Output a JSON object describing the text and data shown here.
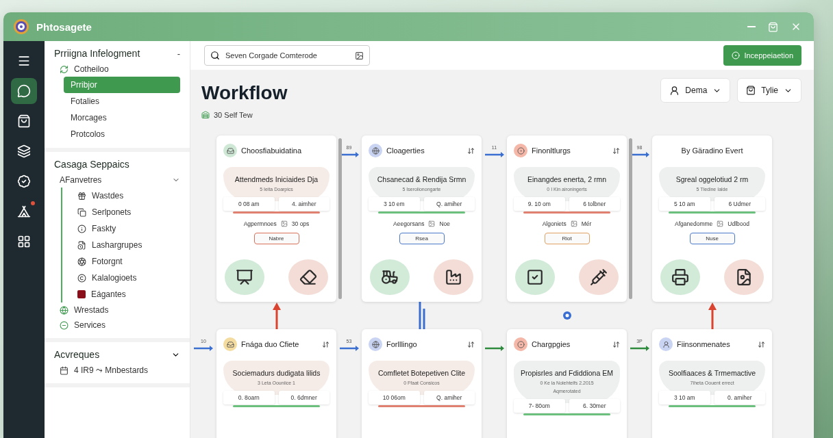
{
  "window": {
    "title": "Phtosagete"
  },
  "rail": [
    {
      "selected": false
    },
    {
      "selected": true
    },
    {
      "selected": false
    },
    {
      "selected": false
    },
    {
      "selected": false
    },
    {
      "selected": false,
      "badge": true
    },
    {
      "selected": false
    }
  ],
  "sidebar": {
    "sections": [
      {
        "title": "Prriigna Infelogment",
        "toggle": "-",
        "groups": [
          {
            "label": "Cotheiloo",
            "children": [
              {
                "label": "Prribjor",
                "selected": true
              },
              {
                "label": "Fotalies",
                "selected": false
              },
              {
                "label": "Morcages",
                "selected": false
              },
              {
                "label": "Protcolos",
                "selected": false
              }
            ]
          }
        ]
      },
      {
        "title": "Casaga Seppaics",
        "groups": [
          {
            "label": "AFanvetres",
            "expanded": true,
            "children": [
              {
                "label": "Wastdes",
                "selected": false
              },
              {
                "label": "Serlponets",
                "selected": false
              },
              {
                "label": "Faskty",
                "selected": false
              },
              {
                "label": "Lashargrupes",
                "selected": false
              },
              {
                "label": "Fotorgnt",
                "selected": false
              },
              {
                "label": "Kalalogioets",
                "selected": false
              },
              {
                "label": "Eágantes",
                "selected": false
              }
            ]
          },
          {
            "label": "Wrestads"
          },
          {
            "label": "Services"
          }
        ]
      },
      {
        "title": "Acvreques",
        "groups": [
          {
            "label": "4 IR9 ⤳ Mnbestards"
          }
        ]
      }
    ]
  },
  "topbar": {
    "search": {
      "placeholder": "Seven Corgade Comterode"
    },
    "action": "Inceppeiaetion"
  },
  "page": {
    "title": "Workflow",
    "subtitle": "30 Self Tew",
    "filters": [
      "Dema",
      "Tylie"
    ]
  },
  "rows": [
    {
      "cards": [
        {
          "title": "Choosfiabuidatina",
          "color": "#cfe8d6",
          "menu": false,
          "scroll": true,
          "summary": "Attendmeds Iniciaides Dja",
          "detail": "5 Ieita Doarpics",
          "times": [
            "0 08 am",
            "4. aimher"
          ],
          "assignee": "Agpermnoes",
          "assign_value": "30 ops",
          "status": {
            "label": "Nabre",
            "color": "#d9705a"
          }
        },
        {
          "connector": {
            "label": "89",
            "color": "#3a6fd1"
          },
          "title": "Cloagerties",
          "color": "#c9d3f2",
          "menu": true,
          "scroll": false,
          "summary": "Chsanecad & Rendija Srmn",
          "detail": "5 Iserolionongarte",
          "times": [
            "3 10 em",
            "Q. amiher"
          ],
          "assignee": "Aeegorsans",
          "assign_value": "Noe",
          "status": {
            "label": "Rsea",
            "color": "#4a79c9"
          }
        },
        {
          "connector": {
            "label": "11",
            "color": "#3a6fd1"
          },
          "title": "Finonltlurgs",
          "color": "#f4b7a8",
          "menu": true,
          "scroll": true,
          "summary": "Einangdes enerta, 2 rmn",
          "detail": "0 I Kin aironingerts",
          "times": [
            "9. 10 om",
            "6 tolbner"
          ],
          "assignee": "Algoniets",
          "assign_value": "Mér",
          "status": {
            "label": "Riot",
            "color": "#e0a060"
          }
        },
        {
          "connector": {
            "label": "98",
            "color": "#3a6fd1"
          },
          "title": "By Gäradino Evert",
          "menu": false,
          "scroll": false,
          "summary": "Sgreal oggelotiud 2 rm",
          "detail": "5 Tledine Ialde",
          "times": [
            "5 10 am",
            "6 Udmer"
          ],
          "assignee": "Afganedomme",
          "assign_value": "Udlbood",
          "status": {
            "label": "Nuse",
            "color": "#4a79c9"
          }
        }
      ]
    },
    {
      "cards": [
        {
          "connector": {
            "label": "10",
            "color": "#3a6fd1"
          },
          "title": "Fnága duo Cfiete",
          "color": "#f4dca0",
          "menu": true,
          "scroll": false,
          "summary": "Sociemadurs dudigata lilids",
          "detail": "3 Leta Oouniice 1",
          "times": [
            "0. 8oarn",
            "0. 6dmner"
          ]
        },
        {
          "connector": {
            "label": "53",
            "color": "#3a6fd1"
          },
          "title": "Forlllingo",
          "color": "#c9d3f2",
          "menu": true,
          "scroll": false,
          "summary": "Comfletet Botepetiven Clite",
          "detail": "0 Ffaat Consicos",
          "times": [
            "10 06om",
            "Q. amiher"
          ]
        },
        {
          "connector": {
            "color": "#2e8b3e"
          },
          "title": "Chargpgies",
          "color": "#f4b7a8",
          "menu": true,
          "scroll": false,
          "summary": "Propisrles and Fdiddiona EM",
          "detail": "0 Ke la Nolehtelfs 2.2015",
          "note": "Aqmerotated",
          "times": [
            "7- 80om",
            "6. 30mer"
          ]
        },
        {
          "connector": {
            "label": "3P",
            "color": "#2e8b3e"
          },
          "title": "Fiinsonmenates",
          "color": "#c9d3f2",
          "menu": true,
          "scroll": false,
          "summary": "Soolfiaaces & Trmemactive",
          "detail": "7Iheta Oouent errect",
          "times": [
            "3 10 am",
            "0. amiher"
          ]
        }
      ]
    }
  ],
  "links": [
    {
      "kind": "arrow",
      "color": "#d9432f"
    },
    {
      "kind": "bar",
      "color": "#3a6fd1"
    },
    {
      "kind": "dot",
      "color": "#3a6fd1"
    },
    {
      "kind": "arrow",
      "color": "#d9432f"
    }
  ]
}
